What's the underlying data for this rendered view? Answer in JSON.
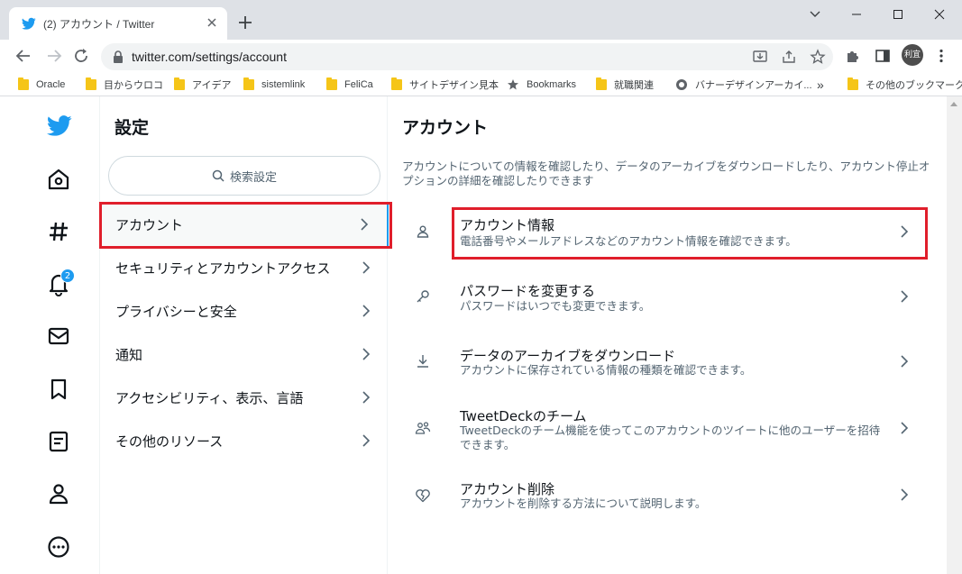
{
  "browser": {
    "tab": {
      "title": "(2) アカウント / Twitter"
    },
    "url": "twitter.com/settings/account",
    "profile_label": "利宜",
    "bookmarks": [
      {
        "label": "Oracle",
        "icon": "folder-icon"
      },
      {
        "label": "目からウロコ",
        "icon": "folder-icon"
      },
      {
        "label": "アイデア",
        "icon": "folder-icon"
      },
      {
        "label": "sistemlink",
        "icon": "folder-icon"
      },
      {
        "label": "FeliCa",
        "icon": "folder-icon"
      },
      {
        "label": "サイトデザイン見本",
        "icon": "folder-icon"
      },
      {
        "label": "Bookmarks",
        "icon": "star-icon"
      },
      {
        "label": "就職関連",
        "icon": "folder-icon"
      },
      {
        "label": "バナーデザインアーカイ...",
        "icon": "globe-icon"
      }
    ],
    "bookmarks_overflow": "»",
    "other_bookmarks": "その他のブックマーク"
  },
  "leftnav": {
    "notification_count": "2",
    "icons": [
      "twitter-logo-icon",
      "home-icon",
      "explore-hash-icon",
      "notifications-bell-icon",
      "messages-mail-icon",
      "bookmarks-icon",
      "lists-icon",
      "profile-icon",
      "more-icon"
    ]
  },
  "settings": {
    "title": "設定",
    "search_placeholder": "検索設定",
    "items": [
      {
        "label": "アカウント"
      },
      {
        "label": "セキュリティとアカウントアクセス"
      },
      {
        "label": "プライバシーと安全"
      },
      {
        "label": "通知"
      },
      {
        "label": "アクセシビリティ、表示、言語"
      },
      {
        "label": "その他のリソース"
      }
    ]
  },
  "account": {
    "title": "アカウント",
    "description": "アカウントについての情報を確認したり、データのアーカイブをダウンロードしたり、アカウント停止オプションの詳細を確認したりできます",
    "rows": [
      {
        "title": "アカウント情報",
        "subtitle": "電話番号やメールアドレスなどのアカウント情報を確認できます。",
        "icon": "person-icon"
      },
      {
        "title": "パスワードを変更する",
        "subtitle": "パスワードはいつでも変更できます。",
        "icon": "key-icon"
      },
      {
        "title": "データのアーカイブをダウンロード",
        "subtitle": "アカウントに保存されている情報の種類を確認できます。",
        "icon": "download-icon"
      },
      {
        "title": "TweetDeckのチーム",
        "subtitle": "TweetDeckのチーム機能を使ってこのアカウントのツイートに他のユーザーを招待できます。",
        "icon": "team-icon"
      },
      {
        "title": "アカウント削除",
        "subtitle": "アカウントを削除する方法について説明します。",
        "icon": "broken-heart-icon"
      }
    ]
  },
  "colors": {
    "accent": "#1d9bf0",
    "highlight": "#e01e2b",
    "muted_text": "#536471"
  }
}
